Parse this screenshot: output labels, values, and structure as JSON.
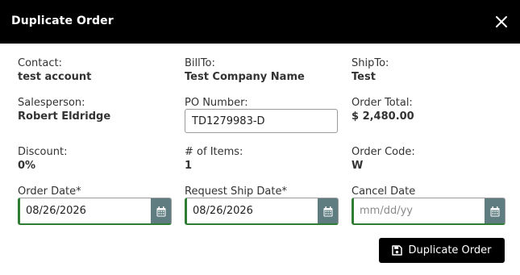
{
  "dialog": {
    "title": "Duplicate Order",
    "close_icon": "close-icon"
  },
  "fields": {
    "contact": {
      "label": "Contact:",
      "value": "test account"
    },
    "bill_to": {
      "label": "BillTo:",
      "value": "Test Company Name"
    },
    "ship_to": {
      "label": "ShipTo:",
      "value": "Test"
    },
    "salesperson": {
      "label": "Salesperson:",
      "value": "Robert Eldridge"
    },
    "po_number": {
      "label": "PO Number:",
      "value": "TD1279983-D"
    },
    "order_total": {
      "label": "Order Total:",
      "value": "$ 2,480.00"
    },
    "discount": {
      "label": "Discount:",
      "value": "0%"
    },
    "num_items": {
      "label": "# of Items:",
      "value": "1"
    },
    "order_code": {
      "label": "Order Code:",
      "value": "W"
    }
  },
  "dates": {
    "order_date": {
      "label": "Order Date*",
      "value": "08/26/2026",
      "placeholder": ""
    },
    "request_ship_date": {
      "label": "Request Ship Date*",
      "value": "08/26/2026",
      "placeholder": ""
    },
    "cancel_date": {
      "label": "Cancel Date",
      "value": "",
      "placeholder": "mm/dd/yy"
    }
  },
  "actions": {
    "submit_label": "Duplicate Order",
    "submit_icon": "save-icon"
  },
  "colors": {
    "header_bg": "#000000",
    "valid_border": "#2e7d32",
    "calendar_button": "#5f7d80",
    "primary_button": "#000000"
  }
}
